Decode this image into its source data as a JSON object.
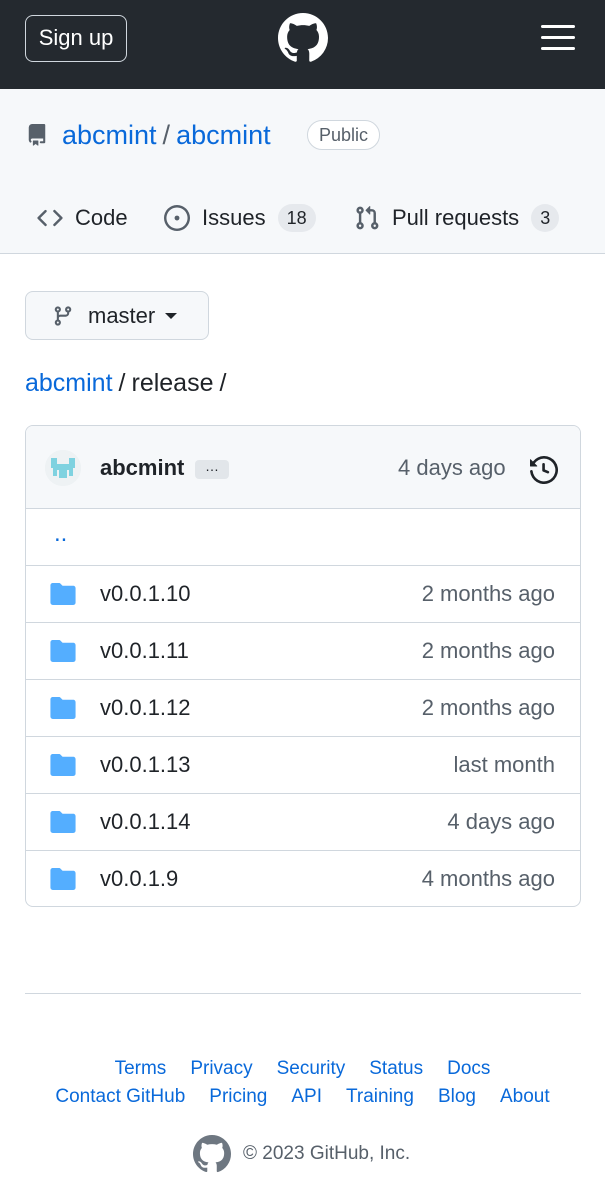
{
  "header": {
    "signup_label": "Sign up",
    "logo_icon": "github-mark-icon",
    "menu_icon": "hamburger-menu-icon"
  },
  "repo": {
    "owner": "abcmint",
    "separator": "/",
    "name": "abcmint",
    "visibility": "Public"
  },
  "tabs": [
    {
      "label": "Code",
      "icon": "code-icon",
      "active": true
    },
    {
      "label": "Issues",
      "icon": "issue-opened-icon",
      "count": "18"
    },
    {
      "label": "Pull requests",
      "icon": "git-pull-request-icon",
      "count": "3"
    }
  ],
  "branch": {
    "label": "master",
    "icon": "git-branch-icon"
  },
  "breadcrumb": {
    "root": "abcmint",
    "separator": "/",
    "folder": "release",
    "trailing": "/"
  },
  "commit": {
    "author": "abcmint",
    "ellipsis": "…",
    "age": "4 days ago",
    "history_icon": "history-icon"
  },
  "files": {
    "parent_link": "..",
    "rows": [
      {
        "name": "v0.0.1.10",
        "age": "2 months ago"
      },
      {
        "name": "v0.0.1.11",
        "age": "2 months ago"
      },
      {
        "name": "v0.0.1.12",
        "age": "2 months ago"
      },
      {
        "name": "v0.0.1.13",
        "age": "last month"
      },
      {
        "name": "v0.0.1.14",
        "age": "4 days ago"
      },
      {
        "name": "v0.0.1.9",
        "age": "4 months ago"
      }
    ]
  },
  "footer": {
    "row1": [
      "Terms",
      "Privacy",
      "Security",
      "Status",
      "Docs"
    ],
    "row2": [
      "Contact GitHub",
      "Pricing",
      "API",
      "Training",
      "Blog",
      "About"
    ],
    "copyright": "© 2023 GitHub, Inc."
  },
  "colors": {
    "header_bg": "#24292f",
    "link": "#0969da",
    "folder": "#54aeff",
    "active_tab": "#fd8c73"
  }
}
